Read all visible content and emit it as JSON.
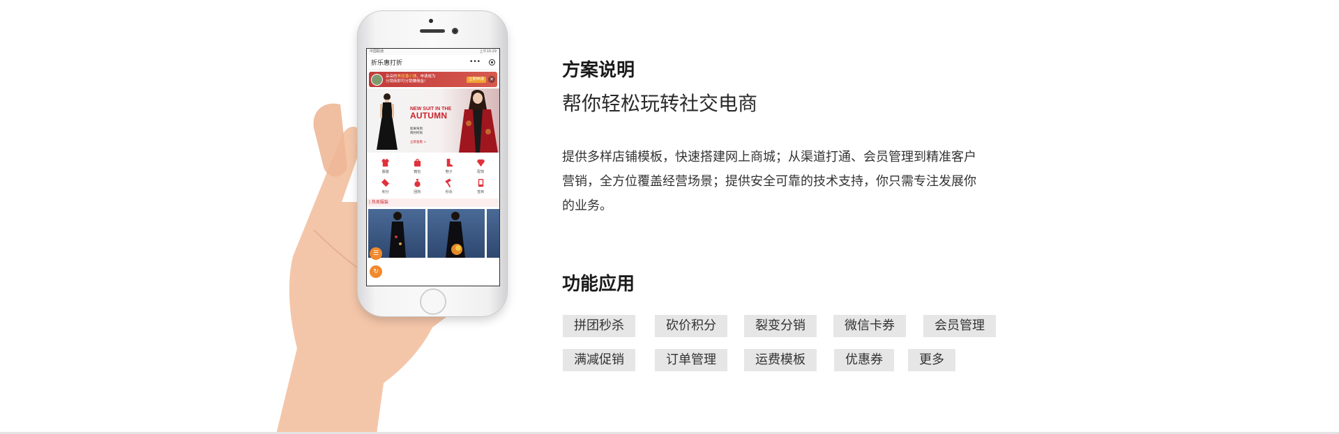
{
  "phone_screen": {
    "status_left": "中国联通",
    "status_right": "上午10:29",
    "app_title": "折乐惠打折",
    "menu_dots": "•••",
    "promo": {
      "text_prefix": "朵朵的",
      "text_highlight": "美丽潘小铺",
      "text_suffix": "，申请成为",
      "text_line2": "分销商即可分销赚佣金!",
      "button": "立即申请",
      "close": "✕"
    },
    "banner": {
      "headline_line1": "NEW SUIT IN THE",
      "headline_line2": "AUTUMN",
      "sub_line1": "新来驾到",
      "sub_line2": "简约时尚",
      "sub_line3": "立即查看 >"
    },
    "categories": [
      {
        "label": "服装",
        "icon": "shirt-icon"
      },
      {
        "label": "箱包",
        "icon": "bag-icon"
      },
      {
        "label": "鞋子",
        "icon": "boot-icon"
      },
      {
        "label": "配饰",
        "icon": "diamond-icon"
      },
      {
        "label": "积分",
        "icon": "ticket-icon"
      },
      {
        "label": "团购",
        "icon": "money-bag-icon"
      },
      {
        "label": "秒杀",
        "icon": "hammer-icon"
      },
      {
        "label": "签到",
        "icon": "phone-icon"
      }
    ],
    "hot_section": "| 热卖服装",
    "float_buttons": [
      "menu-icon",
      "refresh-icon"
    ]
  },
  "plan": {
    "title": "方案说明",
    "subtitle": "帮你轻松玩转社交电商",
    "description_lines": [
      "提供多样店铺模板，快速搭建网上商城；从渠道打通、会员管理到精准客户",
      "营销，全方位覆盖经营场景；提供安全可靠的技术支持，你只需专注发展你",
      "的业务。"
    ]
  },
  "features": {
    "title": "功能应用",
    "tags_row1": [
      "拼团秒杀",
      "砍价积分",
      "裂变分销",
      "微信卡券",
      "会员管理"
    ],
    "tags_row2": [
      "满减促销",
      "订单管理",
      "运费模板",
      "优惠券",
      "更多"
    ]
  },
  "colors": {
    "accent_red": "#c8232c",
    "tag_bg": "#e6e6e6",
    "float_orange": "#f08a2c"
  }
}
